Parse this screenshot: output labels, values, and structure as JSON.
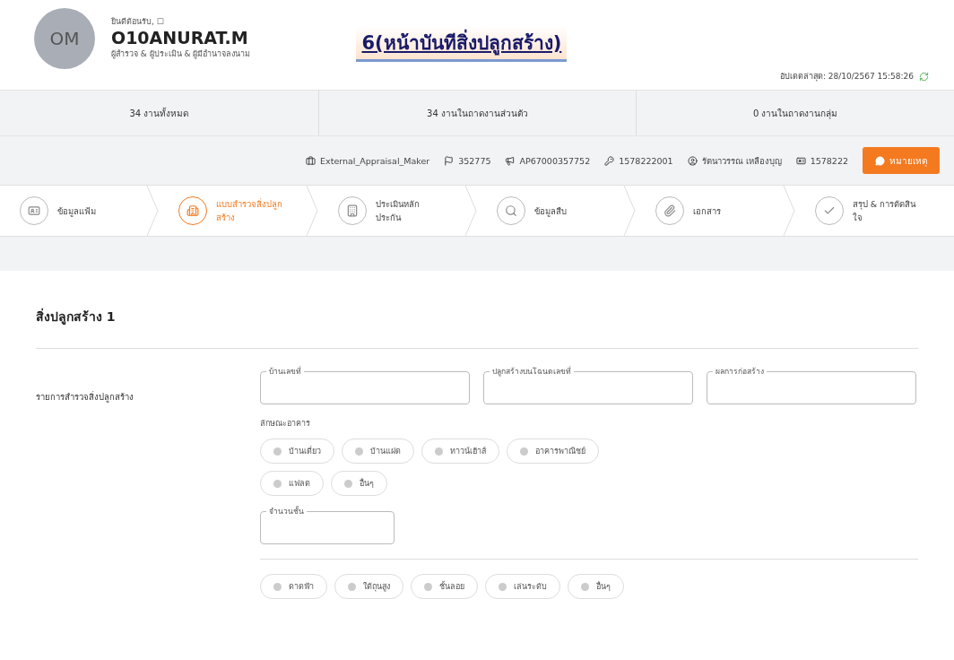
{
  "user": {
    "initials": "OM",
    "greeting": "ยินดีต้อนรับ, ☐",
    "name": "O10ANURAT.M",
    "roles": "ผู้สำรวจ & ผู้ประเมิน & ผู้มีอำนาจลงนาม"
  },
  "page_title": "6(หน้าบันทีสิ่งปลูกสร้าง)",
  "last_updated": "อัปเดตล่าสุด: 28/10/2567 15:58:26",
  "stats": [
    "34 งานทั้งหมด",
    "34 งานในถาดงานส่วนตัว",
    "0 งานในถาดงานกลุ่ม"
  ],
  "info": [
    {
      "kind": "role",
      "text": "External_Appraisal_Maker"
    },
    {
      "kind": "flag",
      "text": "352775"
    },
    {
      "kind": "app",
      "text": "AP67000357752"
    },
    {
      "kind": "key",
      "text": "1578222001"
    },
    {
      "kind": "person",
      "text": "รัตนาวรรณ เหลืองบุญ"
    },
    {
      "kind": "card",
      "text": "1578222"
    }
  ],
  "note_button": "หมายเหตุ",
  "steps": [
    {
      "label": "ข้อมูลแฟ้ม",
      "selected": false
    },
    {
      "label": "แบบสำรวจสิ่งปลูกสร้าง",
      "selected": true
    },
    {
      "label": "ประเมินหลักประกัน",
      "selected": false
    },
    {
      "label": "ข้อมูลสืบ",
      "selected": false
    },
    {
      "label": "เอกสาร",
      "selected": false
    },
    {
      "label": "สรุป & การตัดสินใจ",
      "selected": false
    }
  ],
  "section": {
    "title": "สิ่งปลูกสร้าง 1",
    "row_label": "รายการสำรวจสิ่งปลูกสร้าง",
    "fields": [
      "บ้านเลขที่",
      "ปลูกสร้างบนโฉนดเลขที่",
      "ผลการก่อสร้าง"
    ],
    "building_type_label": "ลักษณะอาคาร",
    "building_types": [
      {
        "label": "บ้านเดี่ยว",
        "selected": false
      },
      {
        "label": "บ้านแฝด",
        "selected": false
      },
      {
        "label": "ทาวน์เฮ้าส์",
        "selected": false
      },
      {
        "label": "อาคารพาณิชย์",
        "selected": false
      },
      {
        "label": "แฟลต",
        "selected": false
      },
      {
        "label": "อื่นๆ",
        "selected": false
      }
    ],
    "floors_field": "จำนวนชั้น",
    "features": [
      {
        "label": "ดาดฟ้า",
        "selected": false
      },
      {
        "label": "ใต้ถุนสูง",
        "selected": false
      },
      {
        "label": "ชั้นลอย",
        "selected": false
      },
      {
        "label": "เล่นระดับ",
        "selected": false
      },
      {
        "label": "อื่นๆ",
        "selected": false
      }
    ]
  }
}
